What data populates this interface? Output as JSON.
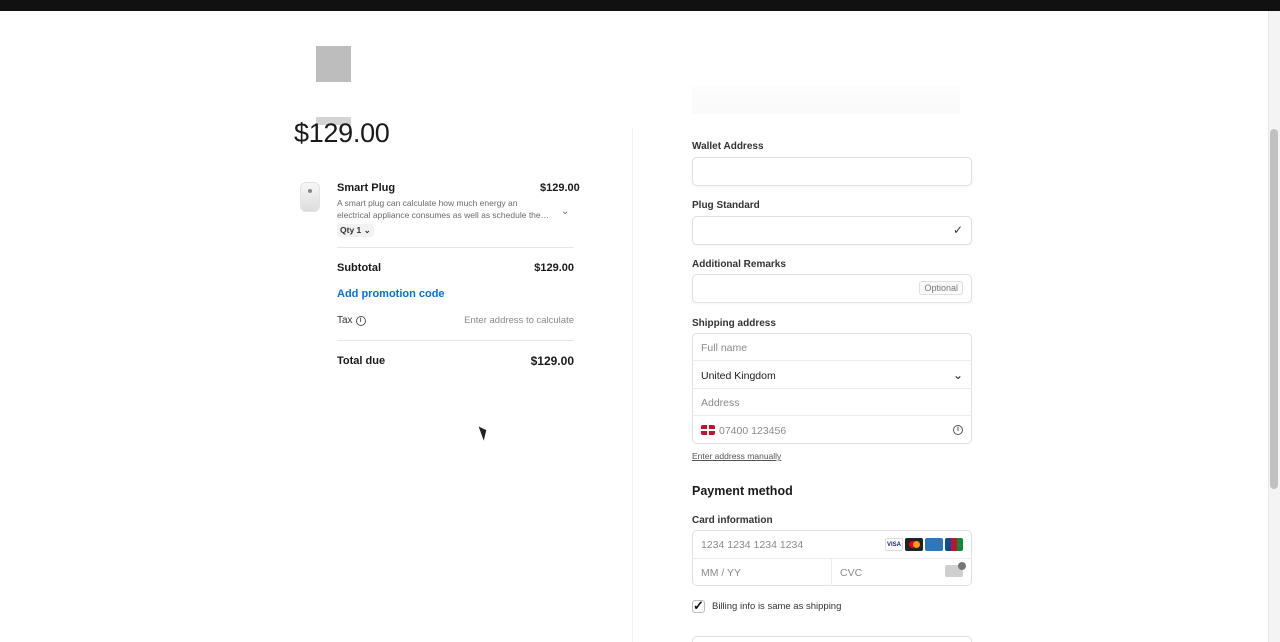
{
  "summary": {
    "amount": "$129.00",
    "product": {
      "name": "Smart Plug",
      "price": "$129.00",
      "description": "A smart plug can calculate how much energy an electrical appliance consumes as well as schedule the…",
      "qty": "Qty 1"
    },
    "subtotal_label": "Subtotal",
    "subtotal_value": "$129.00",
    "promo_label": "Add promotion code",
    "tax_label": "Tax",
    "tax_value": "Enter address to calculate",
    "total_label": "Total due",
    "total_value": "$129.00"
  },
  "form": {
    "wallet_label": "Wallet Address",
    "plug_label": "Plug Standard",
    "remarks_label": "Additional Remarks",
    "remarks_optional": "Optional",
    "shipping_label": "Shipping address",
    "fullname_placeholder": "Full name",
    "country_value": "United Kingdom",
    "address_placeholder": "Address",
    "phone_placeholder": "07400 123456",
    "manual_link": "Enter address manually",
    "payment_title": "Payment method",
    "card_label": "Card information",
    "card_number_placeholder": "1234 1234 1234 1234",
    "expiry_placeholder": "MM / YY",
    "cvc_placeholder": "CVC",
    "billing_label": "Billing info is same as shipping",
    "billing_checked": true
  },
  "brands": [
    {
      "name": "VISA",
      "color": "#ffffff",
      "text": "#1a1f71"
    },
    {
      "name": "MC",
      "color": "#eb001b",
      "text": "#ffffff"
    },
    {
      "name": "AMEX",
      "color": "#2e77bc",
      "text": "#ffffff"
    },
    {
      "name": "JCB",
      "color": "#0b8a3a",
      "text": "#ffffff"
    }
  ]
}
